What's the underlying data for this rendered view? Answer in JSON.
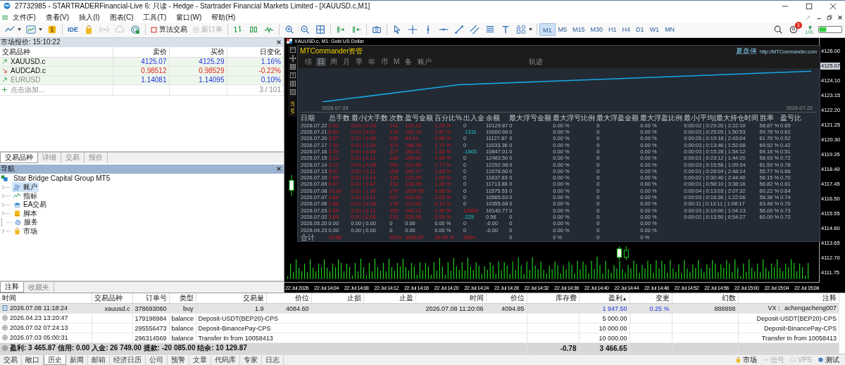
{
  "window": {
    "title": "27732985 - STARTRADERFinancial-Live 6: 只读 - Hedge - Startrader Financial Markets Limited - [XAUUSD.c,M1]"
  },
  "menu": [
    "文件(F)",
    "查看(V)",
    "插入(I)",
    "图表(C)",
    "工具(T)",
    "窗口(W)",
    "帮助(H)"
  ],
  "toolbar": {
    "ide": "IDE",
    "algo_trading": "算法交易",
    "new_order": "新订单",
    "notification_badge": "1",
    "lvl_label": "LVL",
    "timeframes": [
      {
        "label": "M1",
        "selected": true
      },
      {
        "label": "M5",
        "selected": false
      },
      {
        "label": "M15",
        "selected": false
      },
      {
        "label": "M30",
        "selected": false
      },
      {
        "label": "H1",
        "selected": false
      },
      {
        "label": "H4",
        "selected": false
      },
      {
        "label": "D1",
        "selected": false
      },
      {
        "label": "W1",
        "selected": false
      },
      {
        "label": "MN",
        "selected": false
      }
    ]
  },
  "market_watch": {
    "title": "市场报价: 15:10:22",
    "columns": [
      "交易品种",
      "卖价",
      "买价",
      "日变化"
    ],
    "rows": [
      {
        "symbol": "XAUUSD.c",
        "bid": "4125.07",
        "ask": "4125.29",
        "change": "1.16%",
        "rising": true,
        "disabled": false
      },
      {
        "symbol": "AUDCAD.c",
        "bid": "0.98512",
        "ask": "0.98529",
        "change": "-0.22%",
        "rising": false,
        "disabled": false
      },
      {
        "symbol": "EURUSD",
        "bid": "1.14081",
        "ask": "1.14095",
        "change": "0.10%",
        "rising": true,
        "disabled": true
      }
    ],
    "add_label": "点击添加...",
    "count": "3 / 101",
    "tabs": [
      {
        "label": "交易品种",
        "selected": true
      },
      {
        "label": "详细",
        "selected": false
      },
      {
        "label": "交易",
        "selected": false
      },
      {
        "label": "报价",
        "selected": false
      }
    ]
  },
  "navigator": {
    "title": "导航",
    "root": "Star Bridge Capital Group MT5",
    "items": [
      {
        "label": "账户",
        "kind": "accounts",
        "expandable": true,
        "selected": true
      },
      {
        "label": "指标",
        "kind": "indicators",
        "expandable": true,
        "selected": false
      },
      {
        "label": "EA交易",
        "kind": "experts",
        "expandable": true,
        "selected": false
      },
      {
        "label": "脚本",
        "kind": "scripts",
        "expandable": true,
        "selected": false
      },
      {
        "label": "服务",
        "kind": "services",
        "expandable": false,
        "selected": false
      },
      {
        "label": "市场",
        "kind": "market",
        "expandable": true,
        "selected": false
      }
    ],
    "tabs": [
      {
        "label": "注释",
        "selected": true
      },
      {
        "label": "收藏夹",
        "selected": false
      }
    ]
  },
  "chart": {
    "header": "XAUUSD.c, M1: Gold US Dollar",
    "price_labels": [
      {
        "text": "4126.00",
        "current": false
      },
      {
        "text": "4125.07",
        "current": true
      },
      {
        "text": "4124.10",
        "current": false
      },
      {
        "text": "4123.15",
        "current": false
      },
      {
        "text": "4122.20",
        "current": false
      },
      {
        "text": "4121.25",
        "current": false
      },
      {
        "text": "4120.30",
        "current": false
      },
      {
        "text": "4119.35",
        "current": false
      },
      {
        "text": "4118.40",
        "current": false
      },
      {
        "text": "4117.45",
        "current": false
      },
      {
        "text": "4116.50",
        "current": false
      },
      {
        "text": "4115.55",
        "current": false
      },
      {
        "text": "4114.60",
        "current": false
      },
      {
        "text": "4113.65",
        "current": false
      },
      {
        "text": "4112.70",
        "current": false
      },
      {
        "text": "4111.75",
        "current": false
      }
    ],
    "time_labels": [
      "22 Jul 2026",
      "22 Jul 14:04",
      "22 Jul 14:08",
      "22 Jul 14:12",
      "22 Jul 14:16",
      "22 Jul 14:20",
      "22 Jul 14:24",
      "22 Jul 14:28",
      "22 Jul 14:32",
      "22 Jul 14:36",
      "22 Jul 14:40",
      "22 Jul 14:44",
      "22 Jul 14:48",
      "22 Jul 14:52",
      "22 Jul 14:56",
      "22 Jul 15:00",
      "22 Jul 15:04",
      "22 Jul 15:08"
    ]
  },
  "commander": {
    "title": "MTCommander资管",
    "brand": "夏盘侠",
    "url": "http://MTCommander.com",
    "version": "V8.18",
    "tabs": [
      {
        "label": "综",
        "selected": false
      },
      {
        "label": "日",
        "selected": true
      },
      {
        "label": "周",
        "selected": false
      },
      {
        "label": "月",
        "selected": false
      },
      {
        "label": "季",
        "selected": false
      },
      {
        "label": "年",
        "selected": false
      },
      {
        "label": "币",
        "selected": false
      },
      {
        "label": "M",
        "selected": false
      },
      {
        "label": "备",
        "selected": false
      },
      {
        "label": "账户",
        "selected": false
      },
      {
        "label": "轨迹",
        "selected": false
      }
    ],
    "curve_start": "2026.07.03",
    "curve_end": "2026.07.22",
    "columns": [
      "日期",
      "总手数",
      "最小|大手数",
      "次数",
      "盈亏金额",
      "百分比%",
      "出入金",
      "余额",
      "最大浮亏金额",
      "最大浮亏比例",
      "最大浮盈金额",
      "最大浮盈比例",
      "最小|平均|最大持仓时间",
      "胜率",
      "盈亏比"
    ],
    "rows": [
      {
        "profit": true,
        "withdrawal": false,
        "deposit": false,
        "cells": [
          "2026.07.22",
          "2.92",
          "0.01 | 0.18",
          "141",
          "129.21",
          "1.29 %",
          "0",
          "10129.87",
          "0",
          "0.00 %",
          "0",
          "0.00 %",
          "0:00:02 | 0:29:20 | 2:22:10",
          "58.87 %",
          "0.65"
        ]
      },
      {
        "profit": true,
        "withdrawal": true,
        "deposit": false,
        "cells": [
          "2026.07.21",
          "5.60",
          "0.01 | 0.51",
          "179",
          "183.79",
          "1.87 %",
          "-1311",
          "10000.66",
          "0",
          "0.00 %",
          "0",
          "0.00 %",
          "0:00:03 | 0:25:05 | 1:50:53",
          "59.78 %",
          "0.62"
        ]
      },
      {
        "profit": true,
        "withdrawal": false,
        "deposit": false,
        "cells": [
          "2026.07.20",
          "3.57",
          "0.01 | 0.08",
          "235",
          "94.51",
          "0.86 %",
          "0",
          "11127.87",
          "0",
          "0.00 %",
          "0",
          "0.00 %",
          "0:00:05 | 0:19:18 | 2:43:04",
          "61.70 %",
          "0.52"
        ]
      },
      {
        "profit": true,
        "withdrawal": false,
        "deposit": false,
        "cells": [
          "2026.07.17",
          "7.02",
          "0.01 | 0.39",
          "379",
          "186.35",
          "1.72 %",
          "0",
          "11033.36",
          "0",
          "0.00 %",
          "0",
          "0.00 %",
          "0:00:03 | 0:13:46 | 1:52:08",
          "69.92 %",
          "0.42"
        ]
      },
      {
        "profit": true,
        "withdrawal": true,
        "deposit": false,
        "cells": [
          "2026.07.16",
          "3.39",
          "0.01 | 0.08",
          "227",
          "163.51",
          "1.53 %",
          "-1800",
          "10847.01",
          "0",
          "0.00 %",
          "0",
          "0.00 %",
          "0:00:03 | 0:15:28 | 1:54:12",
          "69.16 %",
          "0.51"
        ]
      },
      {
        "profit": true,
        "withdrawal": false,
        "deposit": false,
        "cells": [
          "2026.07.15",
          "3.12",
          "0.01 | 0.11",
          "168",
          "190.52",
          "1.55 %",
          "0",
          "12483.50",
          "0",
          "0.00 %",
          "0",
          "0.00 %",
          "0:00:01 | 0:23:12 | 1:44:20",
          "58.93 %",
          "0.72"
        ]
      },
      {
        "profit": true,
        "withdrawal": false,
        "deposit": false,
        "cells": [
          "2026.07.14",
          "3.11",
          "0.01 | 0.08",
          "200",
          "214.38",
          "1.77 %",
          "0",
          "12292.98",
          "0",
          "0.00 %",
          "0",
          "0.00 %",
          "0:00:03 | 0:15:58 | 1:09:34",
          "61.50 %",
          "0.76"
        ]
      },
      {
        "profit": true,
        "withdrawal": false,
        "deposit": false,
        "cells": [
          "2026.07.13",
          "3.97",
          "0.01 | 0.11",
          "208",
          "240.77",
          "2.03 %",
          "0",
          "12078.60",
          "0",
          "0.00 %",
          "0",
          "0.00 %",
          "0:00:01 | 0:28:04 | 2:48:14",
          "55.77 %",
          "0.66"
        ]
      },
      {
        "profit": true,
        "withdrawal": false,
        "deposit": false,
        "cells": [
          "2026.07.10",
          "2.66",
          "0.01 | 0.14",
          "130",
          "123.95",
          "1.06 %",
          "0",
          "11837.83",
          "0",
          "0.00 %",
          "0",
          "0.00 %",
          "0:00:02 | 0:30:40 | 2:44:40",
          "56.15 %",
          "0.70"
        ]
      },
      {
        "profit": true,
        "withdrawal": false,
        "deposit": false,
        "cells": [
          "2026.07.09",
          "6.97",
          "0.01 | 0.87",
          "132",
          "138.35",
          "1.20 %",
          "0",
          "11713.88",
          "0",
          "0.00 %",
          "0",
          "0.00 %",
          "0:00:01 | 0:58:10 | 3:38:16",
          "56.82 %",
          "0.61"
        ]
      },
      {
        "profit": true,
        "withdrawal": false,
        "deposit": false,
        "cells": [
          "2026.07.08",
          "15.63",
          "0.01 | 1.90",
          "279",
          "1009.90",
          "9.56 %",
          "0",
          "11575.53",
          "0",
          "0.00 %",
          "0",
          "0.00 %",
          "0:00:04 | 0:13:03 | 2:07:32",
          "60.22 %",
          "0.64"
        ]
      },
      {
        "profit": true,
        "withdrawal": false,
        "deposit": false,
        "cells": [
          "2026.07.07",
          "3.60",
          "0.01 | 0.11",
          "197",
          "209.95",
          "2.03 %",
          "0",
          "10565.63",
          "0",
          "0.00 %",
          "0",
          "0.00 %",
          "0:00:03 | 0:16:36 | 1:22:06",
          "58.38 %",
          "0.74"
        ]
      },
      {
        "profit": true,
        "withdrawal": false,
        "deposit": false,
        "cells": [
          "2026.07.06",
          "2.86",
          "0.01 | 0.08",
          "178",
          "214.91",
          "2.12 %",
          "0",
          "10355.68",
          "0",
          "0.00 %",
          "0",
          "0.00 %",
          "0:00:11 | 0:13:11 | 1:08:17",
          "63.48 %",
          "0.70"
        ]
      },
      {
        "profit": true,
        "withdrawal": false,
        "deposit": true,
        "cells": [
          "2026.07.03",
          "2.69",
          "0.01 | 0.11",
          "150",
          "140.21",
          "1.40 %",
          "10000",
          "10140.77",
          "0",
          "0.00 %",
          "0",
          "0.00 %",
          "0:00:03 | 0:19:00 | 1:04:13",
          "56.00 %",
          "0.73"
        ]
      },
      {
        "profit": true,
        "withdrawal": true,
        "deposit": false,
        "cells": [
          "2026.07.02",
          "3.69",
          "0.01 | 0.08",
          "210",
          "225.56",
          "0.00 %",
          "-225",
          "0.56",
          "0",
          "0.00 %",
          "0",
          "0.00 %",
          "0:00:02 | 0:13:50 | 0:54:27",
          "60.00 %",
          "0.72"
        ]
      },
      {
        "profit": false,
        "withdrawal": false,
        "deposit": false,
        "cells": [
          "2026.05.20",
          "0.00",
          "0.00 | 0.00",
          "0",
          "0.00",
          "0.00 %",
          "0",
          "-0.00",
          "0",
          "0.00 %",
          "0",
          "0.00 %"
        ]
      },
      {
        "profit": false,
        "withdrawal": false,
        "deposit": false,
        "cells": [
          "2026.04.23",
          "0.00",
          "0.00 | 0.00",
          "0",
          "0.00",
          "0.00 %",
          "0",
          "-0.00",
          "0",
          "0.00 %",
          "0",
          "0.00 %"
        ]
      }
    ],
    "total": {
      "label": "合计",
      "lots": "70.80",
      "count": "3013",
      "pnl": "3465.87",
      "pct": "29.99 %",
      "flow": "6664",
      "max_float_loss": "0",
      "max_float_loss_pct": "0 %",
      "max_float_profit": "0",
      "max_float_profit_pct": "0 %"
    }
  },
  "history": {
    "columns": [
      {
        "label": "时间"
      },
      {
        "label": "交易品种"
      },
      {
        "label": "订单号"
      },
      {
        "label": "类型"
      },
      {
        "label": "交易量"
      },
      {
        "label": "价位"
      },
      {
        "label": "止损"
      },
      {
        "label": "止盈"
      },
      {
        "label": "时间"
      },
      {
        "label": "价位"
      },
      {
        "label": "库存费"
      },
      {
        "label": "盈利",
        "sort_arrow": "▲"
      },
      {
        "label": "变更"
      },
      {
        "label": "幻数"
      },
      {
        "label": "注释"
      }
    ],
    "rows": [
      {
        "kind": "trade",
        "selected": true,
        "open_time": "2026.07.08 11:18:24",
        "symbol": "xauusd.c",
        "order": "378693060",
        "type": "buy",
        "volume": "1.9",
        "open_price": "4084.60",
        "close_time": "2026.07.08 11:20:06",
        "close_price": "4094.85",
        "profit": "1 947.50",
        "change": "0.25 %",
        "magic": "888898",
        "comment": "VX：  achengacheng007"
      },
      {
        "kind": "balance",
        "selected": false,
        "open_time": "2026.04.23 13:20:47",
        "order": "179198984",
        "type": "balance",
        "description": "Deposit-USDT(BEP20)-CPS",
        "profit": "5 000.00",
        "comment": "Deposit-USDT(BEP20)-CPS"
      },
      {
        "kind": "balance",
        "selected": false,
        "open_time": "2026.07.02 07:24:13",
        "order": "295556473",
        "type": "balance",
        "description": "Deposit-BinancePay-CPS",
        "profit": "10 000.00",
        "comment": "Deposit-BinancePay-CPS"
      },
      {
        "kind": "balance",
        "selected": false,
        "open_time": "2026.07.03 05:00:31",
        "order": "296314569",
        "type": "balance",
        "description": "Transfer In from 10058413",
        "profit": "10 000.00",
        "comment": "Transfer In from 10058413"
      }
    ],
    "summary": {
      "text": "盈利: 3 465.87  信用: 0.00  入金: 26 749.00  提款: -20 085.00  结余: 10 129.87",
      "swap": "-0.78",
      "profit": "3 466.65"
    }
  },
  "bottom_tabs": [
    {
      "label": "交易",
      "selected": false
    },
    {
      "label": "敞口",
      "selected": false
    },
    {
      "label": "历史",
      "selected": true
    },
    {
      "label": "新闻",
      "selected": false
    },
    {
      "label": "邮箱",
      "selected": false
    },
    {
      "label": "经济日历",
      "selected": false
    },
    {
      "label": "公司",
      "selected": false
    },
    {
      "label": "预警",
      "selected": false
    },
    {
      "label": "文章",
      "selected": false
    },
    {
      "label": "代码库",
      "selected": false
    },
    {
      "label": "专家",
      "selected": false
    },
    {
      "label": "日志",
      "selected": false
    }
  ],
  "status": [
    {
      "label": "市场",
      "kind": "market",
      "disabled": false
    },
    {
      "label": "信号",
      "kind": "signals",
      "disabled": true
    },
    {
      "label": "VPS",
      "kind": "vps",
      "disabled": true
    },
    {
      "label": "测试",
      "kind": "tester",
      "disabled": false
    }
  ]
}
